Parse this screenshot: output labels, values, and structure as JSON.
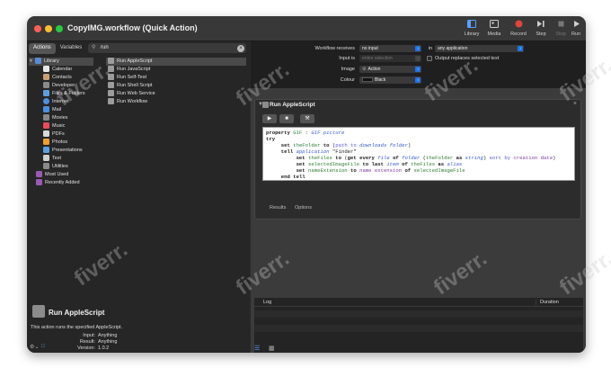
{
  "window": {
    "title": "CopyIMG.workflow (Quick Action)"
  },
  "toolbar": {
    "buttons": [
      {
        "label": "Library",
        "icon": "sidebar-icon"
      },
      {
        "label": "Media",
        "icon": "media-icon"
      },
      {
        "label": "Record",
        "icon": "record-icon"
      },
      {
        "label": "Step",
        "icon": "step-icon"
      },
      {
        "label": "Stop",
        "icon": "stop-icon"
      },
      {
        "label": "Run",
        "icon": "play-icon"
      }
    ]
  },
  "left_tabs": {
    "actions": "Actions",
    "variables": "Variables"
  },
  "search": {
    "value": "run"
  },
  "library": {
    "items": [
      {
        "label": "Library",
        "color": "#5b8ad6"
      },
      {
        "label": "Calendar",
        "color": "#e8e8e8"
      },
      {
        "label": "Contacts",
        "color": "#c8a070"
      },
      {
        "label": "Developer",
        "color": "#8a8a8a"
      },
      {
        "label": "Files & Folders",
        "color": "#5aa0e0"
      },
      {
        "label": "Internet",
        "color": "#4a90e2"
      },
      {
        "label": "Mail",
        "color": "#4a90e2"
      },
      {
        "label": "Movies",
        "color": "#888888"
      },
      {
        "label": "Music",
        "color": "#e94b5b"
      },
      {
        "label": "PDFs",
        "color": "#d9d9d9"
      },
      {
        "label": "Photos",
        "color": "#f0a030"
      },
      {
        "label": "Presentations",
        "color": "#5aa0e0"
      },
      {
        "label": "Text",
        "color": "#cfcfcf"
      },
      {
        "label": "Utilities",
        "color": "#8a8a8a"
      },
      {
        "label": "Most Used",
        "color": "#9b59b6"
      },
      {
        "label": "Recently Added",
        "color": "#9b59b6"
      }
    ]
  },
  "actions": {
    "items": [
      {
        "label": "Run AppleScript"
      },
      {
        "label": "Run JavaScript"
      },
      {
        "label": "Run Self-Test"
      },
      {
        "label": "Run Shell Script"
      },
      {
        "label": "Run Web Service"
      },
      {
        "label": "Run Workflow"
      }
    ]
  },
  "description": {
    "title": "Run AppleScript",
    "text": "This action runs the specified AppleScript.",
    "input_label": "Input:",
    "input_value": "Anything",
    "result_label": "Result:",
    "result_value": "Anything",
    "version_label": "Version:",
    "version_value": "1.0.2"
  },
  "workflow": {
    "receives_label": "Workflow receives",
    "receives_value": "no input",
    "in_label": "in",
    "in_value": "any application",
    "input_is_label": "Input is",
    "input_is_value": "entire selection",
    "output_replaces_label": "Output replaces selected text",
    "image_label": "Image",
    "image_value": "Action",
    "colour_label": "Colour",
    "colour_value": "Black"
  },
  "action_card": {
    "title": "Run AppleScript",
    "tab_results": "Results",
    "tab_options": "Options"
  },
  "log": {
    "col_log": "Log",
    "col_duration": "Duration"
  }
}
